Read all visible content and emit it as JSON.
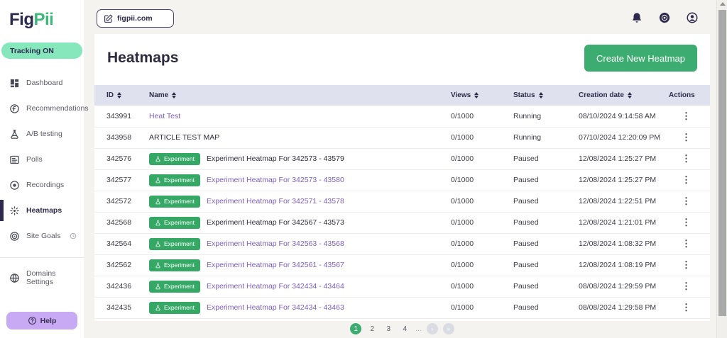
{
  "brand": {
    "logo_fig": "Fig",
    "logo_pii": "Pii"
  },
  "sidebar": {
    "tracking_label": "Tracking ON",
    "items": [
      {
        "label": "Dashboard",
        "icon": "dashboard-icon",
        "active": false
      },
      {
        "label": "Recommendations",
        "icon": "recommendations-icon",
        "active": false
      },
      {
        "label": "A/B testing",
        "icon": "ab-testing-icon",
        "active": false
      },
      {
        "label": "Polls",
        "icon": "polls-icon",
        "active": false
      },
      {
        "label": "Recordings",
        "icon": "recordings-icon",
        "active": false
      },
      {
        "label": "Heatmaps",
        "icon": "heatmaps-icon",
        "active": true
      },
      {
        "label": "Site Goals",
        "icon": "site-goals-icon",
        "active": false,
        "trailing_icon": "clock-icon"
      }
    ],
    "domains_settings": {
      "label": "Domains Settings",
      "icon": "globe-icon"
    },
    "help_label": "Help"
  },
  "topbar": {
    "domain_selector": {
      "value": "figpii.com",
      "icon": "edit-icon"
    },
    "icons": [
      "bell-icon",
      "gear-icon",
      "account-icon"
    ]
  },
  "page": {
    "title": "Heatmaps",
    "create_button_label": "Create New Heatmap"
  },
  "table": {
    "columns": [
      {
        "label": "ID",
        "sortable": true
      },
      {
        "label": "Name",
        "sortable": true
      },
      {
        "label": "Views",
        "sortable": true
      },
      {
        "label": "Status",
        "sortable": true
      },
      {
        "label": "Creation date",
        "sortable": true
      },
      {
        "label": "Actions",
        "sortable": false
      }
    ],
    "rows": [
      {
        "id": "343991",
        "badge": null,
        "name": "Heat Test",
        "name_is_link": true,
        "views": "0/1000",
        "status": "Running",
        "created": "08/10/2024 9:14:58 AM"
      },
      {
        "id": "343958",
        "badge": null,
        "name": "ARTICLE TEST MAP",
        "name_is_link": false,
        "views": "0/1000",
        "status": "Running",
        "created": "07/10/2024 12:20:09 PM"
      },
      {
        "id": "342576",
        "badge": "Experiment",
        "name": "Experiment Heatmap For 342573 - 43579",
        "name_is_link": false,
        "views": "0/1000",
        "status": "Paused",
        "created": "12/08/2024 1:25:27 PM"
      },
      {
        "id": "342577",
        "badge": "Experiment",
        "name": "Experiment Heatmap For 342573 - 43580",
        "name_is_link": true,
        "views": "0/1000",
        "status": "Paused",
        "created": "12/08/2024 1:25:27 PM"
      },
      {
        "id": "342572",
        "badge": "Experiment",
        "name": "Experiment Heatmap For 342571 - 43578",
        "name_is_link": true,
        "views": "0/1000",
        "status": "Paused",
        "created": "12/08/2024 1:22:51 PM"
      },
      {
        "id": "342568",
        "badge": "Experiment",
        "name": "Experiment Heatmap For 342567 - 43573",
        "name_is_link": false,
        "views": "0/1000",
        "status": "Paused",
        "created": "12/08/2024 1:21:01 PM"
      },
      {
        "id": "342564",
        "badge": "Experiment",
        "name": "Experiment Heatmap For 342563 - 43568",
        "name_is_link": true,
        "views": "0/1000",
        "status": "Paused",
        "created": "12/08/2024 1:08:32 PM"
      },
      {
        "id": "342562",
        "badge": "Experiment",
        "name": "Experiment Heatmap For 342561 - 43567",
        "name_is_link": true,
        "views": "0/1000",
        "status": "Paused",
        "created": "12/08/2024 1:08:19 PM"
      },
      {
        "id": "342436",
        "badge": "Experiment",
        "name": "Experiment Heatmap For 342434 - 43464",
        "name_is_link": true,
        "views": "0/1000",
        "status": "Paused",
        "created": "08/08/2024 1:29:59 PM"
      },
      {
        "id": "342435",
        "badge": "Experiment",
        "name": "Experiment Heatmap For 342434 - 43463",
        "name_is_link": true,
        "views": "0/1000",
        "status": "Paused",
        "created": "08/08/2024 1:29:58 PM"
      }
    ],
    "badge_icon": "flask-icon",
    "actions_icon": "kebab-menu-icon"
  },
  "pagination": {
    "pages": [
      "1",
      "2",
      "3",
      "4"
    ],
    "active_page": "1",
    "ellipsis": "...",
    "next_label": "›",
    "last_label": "»"
  },
  "colors": {
    "accent_green": "#3dac71",
    "badge_green": "#35a866",
    "mint_green": "#86e7bd",
    "brand_navy": "#2e2a4d",
    "link_purple": "#7d5ec2",
    "help_purple": "#c8a9f4",
    "table_header_bg": "#dfe2ee",
    "page_bg": "#f4f3f0"
  }
}
